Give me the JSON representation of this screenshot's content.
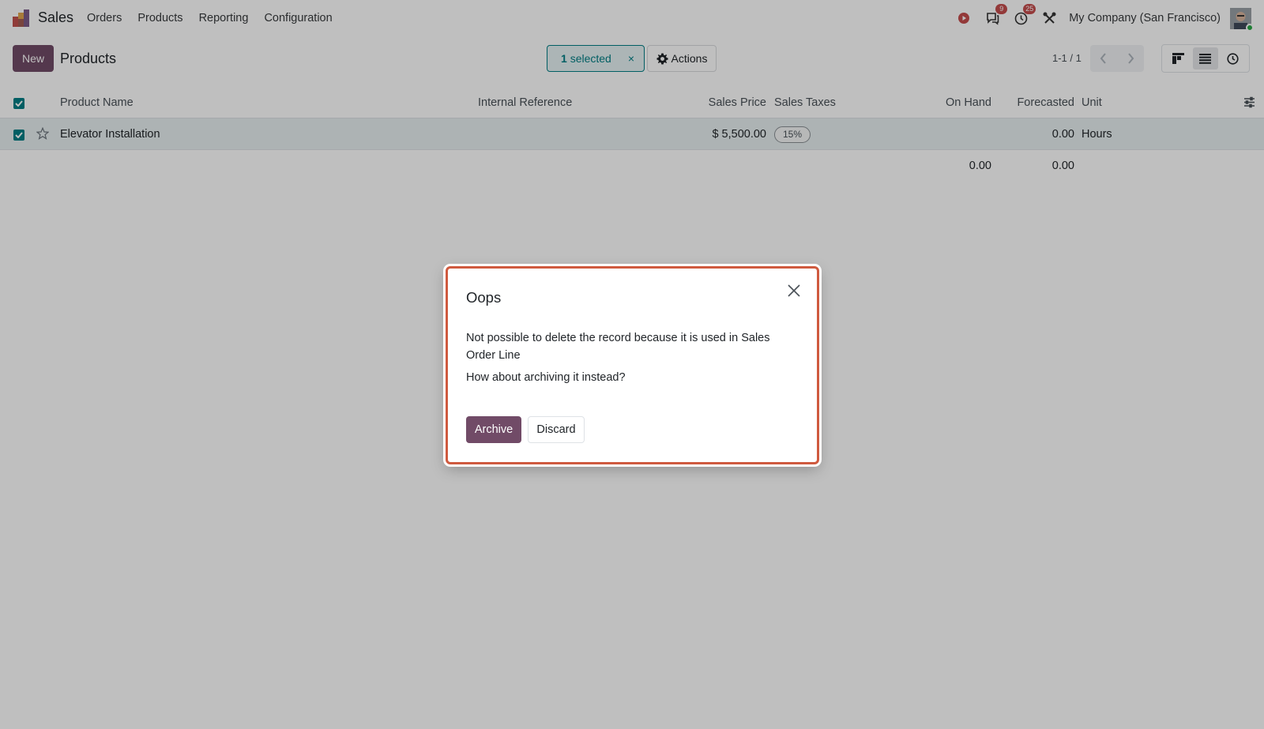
{
  "navbar": {
    "app_name": "Sales",
    "menu": [
      "Orders",
      "Products",
      "Reporting",
      "Configuration"
    ],
    "messages_badge": "9",
    "activities_badge": "25",
    "company": "My Company (San Francisco)",
    "icons": [
      "record-icon",
      "messages-icon",
      "activity-clock-icon",
      "debug-tools-icon",
      "user-avatar"
    ]
  },
  "control_panel": {
    "new_label": "New",
    "breadcrumb": "Products",
    "selected_count": "1",
    "selected_suffix": "selected",
    "clear_label": "×",
    "actions_label": "Actions",
    "pager": "1-1 / 1",
    "views": [
      "kanban",
      "list",
      "activity"
    ],
    "active_view": "list"
  },
  "list": {
    "columns": {
      "name": "Product Name",
      "ref": "Internal Reference",
      "price": "Sales Price",
      "taxes": "Sales Taxes",
      "on_hand": "On Hand",
      "forecasted": "Forecasted",
      "unit": "Unit"
    },
    "rows": [
      {
        "checked": true,
        "name": "Elevator Installation",
        "ref": "",
        "price": "$ 5,500.00",
        "taxes": "15%",
        "on_hand": "",
        "forecasted": "0.00",
        "unit": "Hours"
      }
    ],
    "totals": {
      "on_hand": "0.00",
      "forecasted": "0.00"
    }
  },
  "dialog": {
    "title": "Oops",
    "message": "Not possible to delete the record because it is used in Sales Order Line",
    "question": "How about archiving it instead?",
    "archive_label": "Archive",
    "discard_label": "Discard"
  },
  "colors": {
    "primary": "#714b67",
    "teal": "#017e84",
    "dialog_border": "#cf5a3f",
    "badge": "#c44d4d"
  }
}
